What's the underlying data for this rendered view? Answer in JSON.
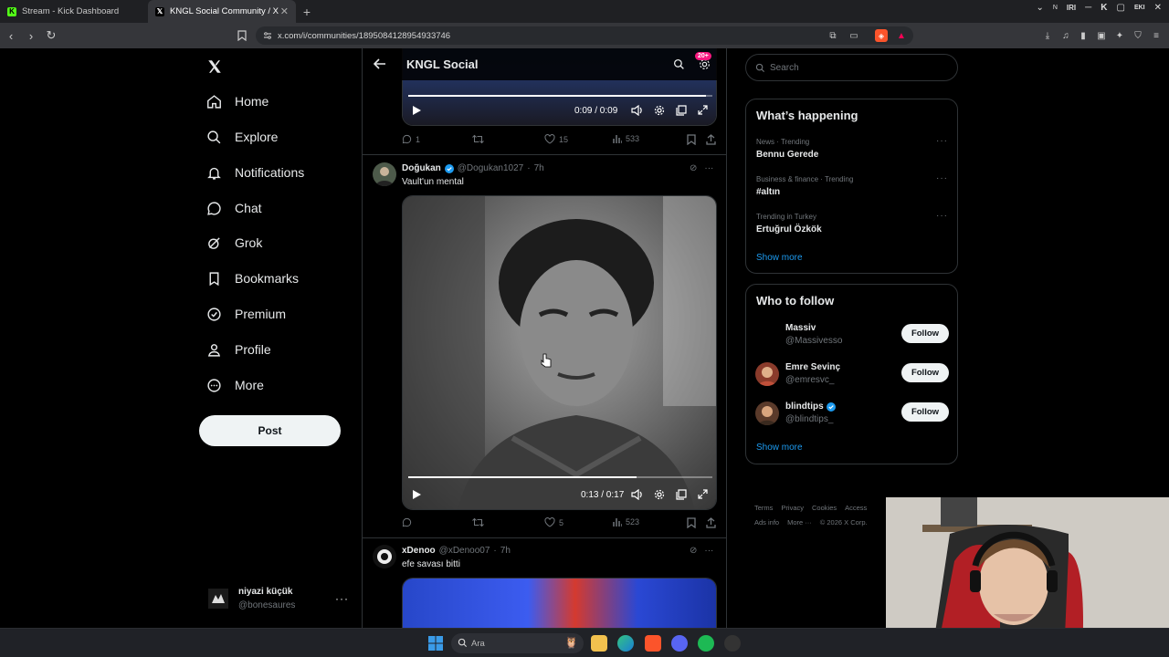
{
  "browser": {
    "tabs": [
      {
        "label": "Stream - Kick Dashboard",
        "active": false
      },
      {
        "label": "KNGL Social Community / X",
        "active": true
      }
    ],
    "url": "x.com/i/communities/1895084128954933746",
    "top_right_labels": [
      "N",
      "IRI",
      "K",
      "EKI"
    ]
  },
  "nav": {
    "items": [
      {
        "label": "Home",
        "icon": "home-icon"
      },
      {
        "label": "Explore",
        "icon": "search-icon"
      },
      {
        "label": "Notifications",
        "icon": "bell-icon"
      },
      {
        "label": "Chat",
        "icon": "chat-icon"
      },
      {
        "label": "Grok",
        "icon": "grok-icon"
      },
      {
        "label": "Bookmarks",
        "icon": "bookmark-icon"
      },
      {
        "label": "Premium",
        "icon": "verified-icon"
      },
      {
        "label": "Profile",
        "icon": "person-icon"
      },
      {
        "label": "More",
        "icon": "more-circle-icon"
      }
    ],
    "post_label": "Post",
    "account": {
      "name": "niyazi küçük",
      "handle": "@bonesaures"
    }
  },
  "community": {
    "title": "KNGL Social",
    "badge": "20+"
  },
  "posts": [
    {
      "video": {
        "time": "0:09 / 0:09",
        "progress": 0.98
      },
      "stats": {
        "replies": "1",
        "reposts": "",
        "likes": "15",
        "views": "533"
      }
    },
    {
      "name": "Doğukan",
      "verified": true,
      "handle": "@Dogukan1027",
      "time": "7h",
      "text": "Vault'un mental",
      "video": {
        "time": "0:13 / 0:17",
        "progress": 0.75
      },
      "stats": {
        "replies": "",
        "reposts": "",
        "likes": "5",
        "views": "523"
      }
    },
    {
      "name": "xDenoo",
      "verified": false,
      "handle": "@xDenoo07",
      "time": "7h",
      "text": "efe savası bitti"
    }
  ],
  "sidebar": {
    "search_placeholder": "Search",
    "happening_title": "What’s happening",
    "trends": [
      {
        "meta": "News · Trending",
        "title": "Bennu Gerede"
      },
      {
        "meta": "Business & finance · Trending",
        "title": "#altın"
      },
      {
        "meta": "Trending in Turkey",
        "title": "Ertuğrul Özkök"
      }
    ],
    "show_more": "Show more",
    "follow_title": "Who to follow",
    "follow": [
      {
        "name": "Massiv",
        "handle": "@Massivesso",
        "verified": false
      },
      {
        "name": "Emre Sevinç",
        "handle": "@emresvc_",
        "verified": false
      },
      {
        "name": "blindtips",
        "handle": "@blindtips_",
        "verified": true
      }
    ],
    "follow_label": "Follow",
    "footer": [
      "Terms",
      "Privacy",
      "Cookies",
      "Access",
      "Ads info",
      "More ···",
      "© 2026 X Corp."
    ]
  },
  "taskbar": {
    "search_placeholder": "Ara"
  },
  "colors": {
    "accent": "#1d9bf0",
    "badge": "#f91880",
    "text": "#e7e9ea",
    "muted": "#71767b",
    "border": "#2f3336"
  }
}
